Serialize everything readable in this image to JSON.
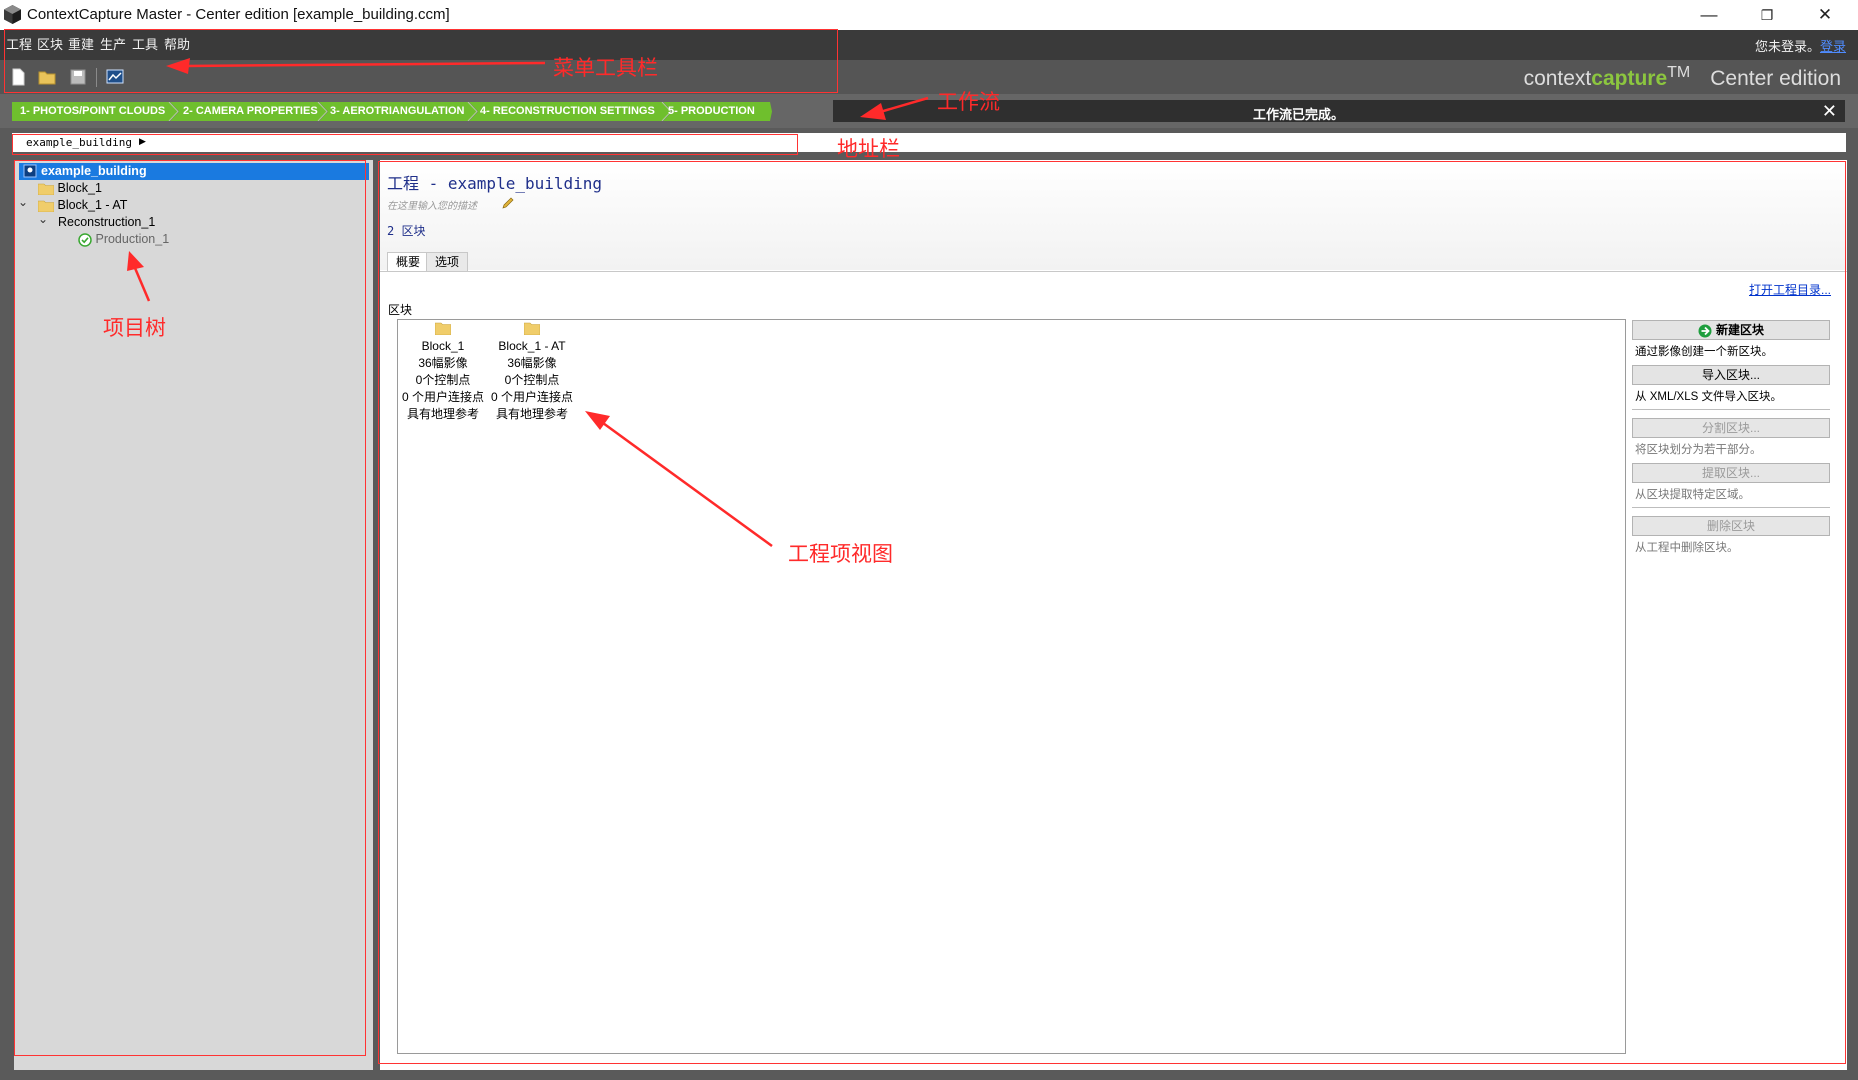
{
  "window": {
    "title": "ContextCapture Master - Center edition [example_building.ccm]",
    "buttons": {
      "minimize": "—",
      "restore": "❐",
      "close": "✕"
    }
  },
  "menu": {
    "items": [
      "工程",
      "区块",
      "重建",
      "生产",
      "工具",
      "帮助"
    ],
    "login_text": "您未登录。",
    "login_link": "登录"
  },
  "toolbar": {
    "icons": [
      "new-project-icon",
      "open-project-icon",
      "save-project-icon",
      "job-monitor-icon"
    ]
  },
  "brand": {
    "context": "context",
    "capture": "capture",
    "tm": "TM",
    "edition": "Center edition"
  },
  "workflow": {
    "steps": [
      "1- PHOTOS/POINT CLOUDS",
      "2- CAMERA PROPERTIES",
      "3- AEROTRIANGULATION",
      "4- RECONSTRUCTION SETTINGS",
      "5- PRODUCTION"
    ],
    "status": "工作流已完成。",
    "close": "✕",
    "step_color": "#6fbf2d",
    "step_color_dark": "#5aa81f"
  },
  "address": {
    "crumb": "example_building",
    "arrow": "▶"
  },
  "tree": {
    "root": "example_building",
    "nodes": [
      "Block_1",
      "Block_1 - AT",
      "Reconstruction_1",
      "Production_1"
    ],
    "expanders": [
      "⌄",
      "⌄"
    ]
  },
  "project": {
    "title": "工程 - example_building",
    "description_placeholder": "在这里输入您的描述",
    "block_count": "2 区块",
    "tabs": [
      "概要",
      "选项"
    ],
    "open_dir_link": "打开工程目录...",
    "blocks_label": "区块",
    "blocks": [
      {
        "name": "Block_1",
        "photos": "36幅影像",
        "controls": "0个控制点",
        "tie_points": "0 个用户连接点",
        "georef": "具有地理参考"
      },
      {
        "name": "Block_1 - AT",
        "photos": "36幅影像",
        "controls": "0个控制点",
        "tie_points": "0 个用户连接点",
        "georef": "具有地理参考"
      }
    ]
  },
  "actions": {
    "new_block": {
      "label": "新建区块",
      "desc": "通过影像创建一个新区块。"
    },
    "import_block": {
      "label": "导入区块...",
      "desc": "从 XML/XLS 文件导入区块。"
    },
    "split_block": {
      "label": "分割区块...",
      "desc": "将区块划分为若干部分。"
    },
    "extract_block": {
      "label": "提取区块...",
      "desc": "从区块提取特定区域。"
    },
    "delete_block": {
      "label": "删除区块",
      "desc": "从工程中删除区块。"
    }
  },
  "annotations": {
    "menu_toolbar": "菜单工具栏",
    "workflow": "工作流",
    "address_bar": "地址栏",
    "project_tree": "项目树",
    "project_view": "工程项视图",
    "color": "#ff2a2a"
  }
}
